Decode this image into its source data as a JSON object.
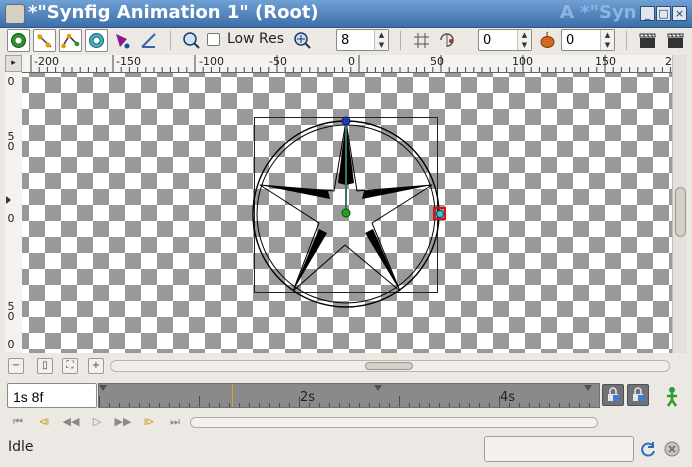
{
  "window": {
    "title": "*\"Synfig Animation 1\" (Root)",
    "ghost_title": "A *\"Syn",
    "controls": [
      "_",
      "□",
      "×"
    ]
  },
  "toolbar": {
    "tools": [
      "draw-vertices-icon",
      "draw-tangents-icon",
      "draw-radius-icon",
      "draw-width-icon",
      "draw-angle-icon",
      "onion-skin-icon"
    ],
    "zoom_icon": "zoom-icon",
    "low_res_label": "Low Res",
    "low_res_checked": false,
    "quality_value": "8",
    "past_onion_value": "0",
    "future_onion_value": "0"
  },
  "rulers": {
    "h_labels": [
      "-200",
      "-150",
      "-100",
      "-50",
      "0",
      "50",
      "100",
      "150",
      "2"
    ],
    "v_labels": [
      "0",
      "5\n0",
      "0",
      "5\n0",
      "0"
    ]
  },
  "timebar": {
    "current_time": "1s 8f",
    "labels": [
      "2s",
      "4s"
    ]
  },
  "status": {
    "text": "Idle"
  },
  "colors": {
    "titlebar": "#4f86c4",
    "checker_dark": "#999999",
    "checker_light": "#ffffff",
    "time_cursor": "#d9a530"
  }
}
